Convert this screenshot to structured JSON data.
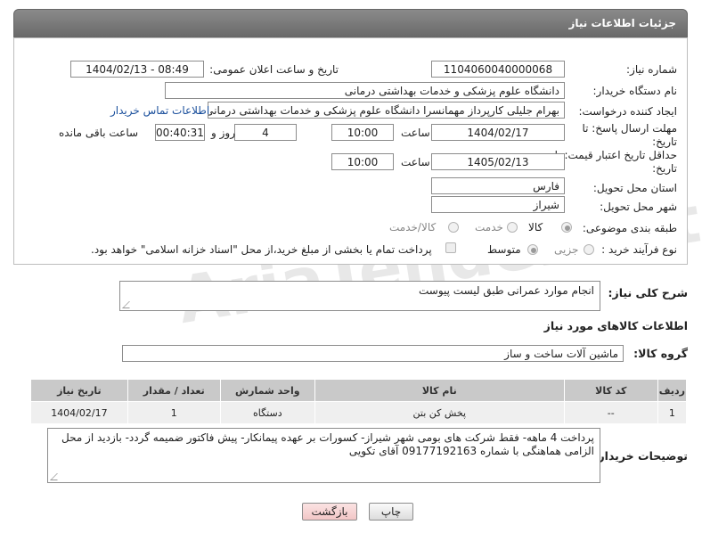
{
  "header": {
    "title": "جزئیات اطلاعات نیاز"
  },
  "form": {
    "need_number": {
      "label": "شماره نیاز:",
      "value": "1104060040000068"
    },
    "announce_datetime": {
      "label": "تاریخ و ساعت اعلان عمومی:",
      "value": "1404/02/13 - 08:49"
    },
    "buyer_org": {
      "label": "نام دستگاه خریدار:",
      "value": "دانشگاه علوم پزشکی و خدمات بهداشتی درمانی"
    },
    "requester": {
      "label": "ایجاد کننده درخواست:",
      "value": "بهرام جلیلی کارپرداز مهمانسرا دانشگاه علوم پزشکی و خدمات بهداشتی درمانی",
      "contact_link": "اطلاعات تماس خریدار"
    },
    "reply_deadline": {
      "label": "مهلت ارسال پاسخ: تا تاریخ:",
      "date": "1404/02/17",
      "time_label": "ساعت",
      "time": "10:00",
      "days": "4",
      "days_label": "روز و",
      "remaining": "00:40:31",
      "remaining_label": "ساعت باقی مانده"
    },
    "price_validity": {
      "label": "حداقل تاریخ اعتبار قیمت: تا تاریخ:",
      "date": "1405/02/13",
      "time_label": "ساعت",
      "time": "10:00"
    },
    "province": {
      "label": "استان محل تحویل:",
      "value": "فارس"
    },
    "city": {
      "label": "شهر محل تحویل:",
      "value": "شیراز"
    },
    "category": {
      "label": "طبقه بندی موضوعی:",
      "options": [
        "کالا",
        "خدمت",
        "کالا/خدمت"
      ],
      "selected": "کالا"
    },
    "purchase_type": {
      "label": "نوع فرآیند خرید :",
      "options": [
        "جزیی",
        "متوسط"
      ],
      "selected": "متوسط",
      "payment_note": "پرداخت تمام یا بخشی از مبلغ خرید،از محل \"اسناد خزانه اسلامی\" خواهد بود."
    }
  },
  "summary": {
    "label": "شرح کلی نیاز:",
    "value": "انجام موارد عمرانی طبق لیست پیوست"
  },
  "goods_section": {
    "title": "اطلاعات کالاهای مورد نیاز"
  },
  "goods_group": {
    "label": "گروه کالا:",
    "value": "ماشین آلات ساخت و ساز"
  },
  "table": {
    "headers": [
      "ردیف",
      "کد کالا",
      "نام کالا",
      "واحد شمارش",
      "تعداد / مقدار",
      "تاریخ نیاز"
    ],
    "rows": [
      [
        "1",
        "--",
        "پخش کن بتن",
        "دستگاه",
        "1",
        "1404/02/17"
      ]
    ]
  },
  "buyer_notes": {
    "label": "توضیحات خریدار:",
    "value": "پرداخت 4 ماهه- فقط شرکت های بومی شهر شیراز- کسورات بر عهده پیمانکار- پیش فاکتور ضمیمه گردد- بازدید از محل الزامی هماهنگی با شماره 09177192163 آقای تکویی"
  },
  "buttons": {
    "print": "چاپ",
    "back": "بازگشت"
  },
  "colors": {
    "header_bg": "#7a7a7a",
    "link": "#1a4f9c",
    "table_header": "#c9c9c9",
    "back_button": "#f2c6c6"
  },
  "watermark": {
    "text": "AriaTender.net"
  }
}
